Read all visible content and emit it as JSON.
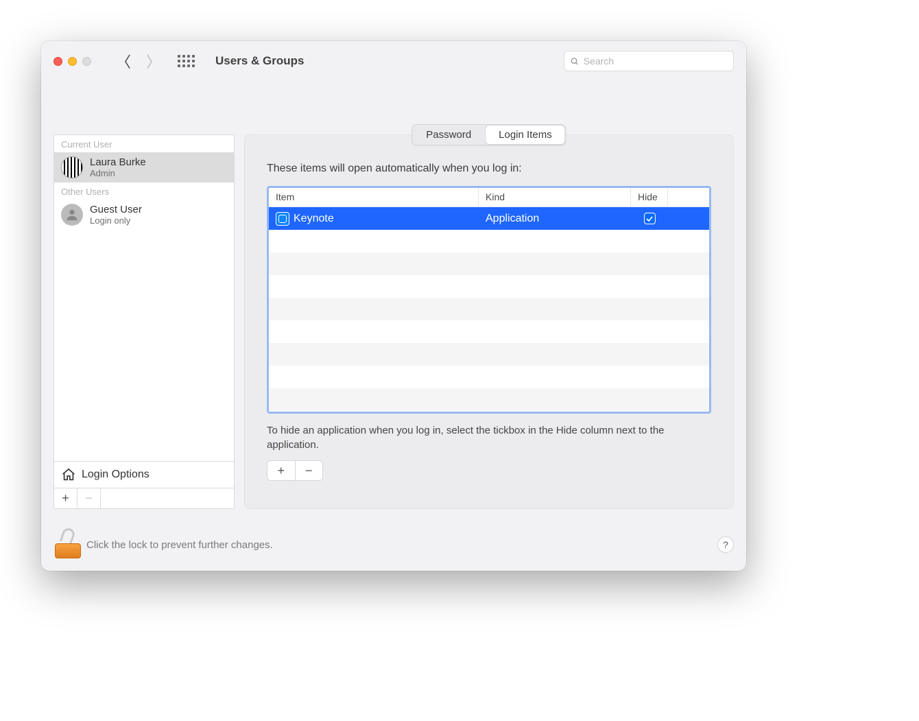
{
  "window": {
    "title": "Users & Groups"
  },
  "search": {
    "placeholder": "Search"
  },
  "sidebar": {
    "section_current": "Current User",
    "section_other": "Other Users",
    "current": {
      "name": "Laura Burke",
      "role": "Admin"
    },
    "other": [
      {
        "name": "Guest User",
        "role": "Login only"
      }
    ],
    "login_options_label": "Login Options"
  },
  "tabs": {
    "password": "Password",
    "login_items": "Login Items",
    "active": "login_items"
  },
  "main": {
    "intro": "These items will open automatically when you log in:",
    "columns": {
      "item": "Item",
      "kind": "Kind",
      "hide": "Hide"
    },
    "rows": [
      {
        "item": "Keynote",
        "kind": "Application",
        "hide": true,
        "selected": true
      }
    ],
    "caption": "To hide an application when you log in, select the tickbox in the Hide column next to the application."
  },
  "footer": {
    "lock_text": "Click the lock to prevent further changes."
  }
}
